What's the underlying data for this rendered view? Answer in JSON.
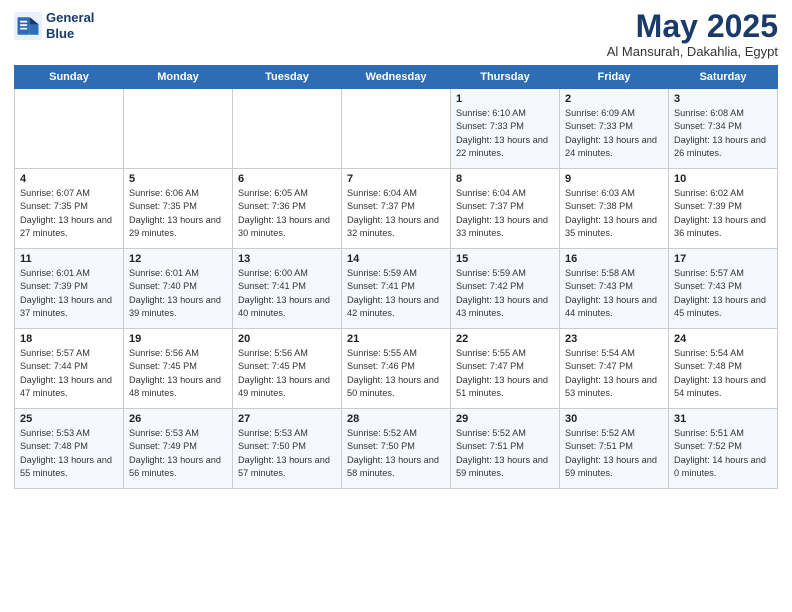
{
  "header": {
    "logo_line1": "General",
    "logo_line2": "Blue",
    "month": "May 2025",
    "location": "Al Mansurah, Dakahlia, Egypt"
  },
  "days_of_week": [
    "Sunday",
    "Monday",
    "Tuesday",
    "Wednesday",
    "Thursday",
    "Friday",
    "Saturday"
  ],
  "weeks": [
    [
      {
        "day": "",
        "sunrise": "",
        "sunset": "",
        "daylight": ""
      },
      {
        "day": "",
        "sunrise": "",
        "sunset": "",
        "daylight": ""
      },
      {
        "day": "",
        "sunrise": "",
        "sunset": "",
        "daylight": ""
      },
      {
        "day": "",
        "sunrise": "",
        "sunset": "",
        "daylight": ""
      },
      {
        "day": "1",
        "sunrise": "Sunrise: 6:10 AM",
        "sunset": "Sunset: 7:33 PM",
        "daylight": "Daylight: 13 hours and 22 minutes."
      },
      {
        "day": "2",
        "sunrise": "Sunrise: 6:09 AM",
        "sunset": "Sunset: 7:33 PM",
        "daylight": "Daylight: 13 hours and 24 minutes."
      },
      {
        "day": "3",
        "sunrise": "Sunrise: 6:08 AM",
        "sunset": "Sunset: 7:34 PM",
        "daylight": "Daylight: 13 hours and 26 minutes."
      }
    ],
    [
      {
        "day": "4",
        "sunrise": "Sunrise: 6:07 AM",
        "sunset": "Sunset: 7:35 PM",
        "daylight": "Daylight: 13 hours and 27 minutes."
      },
      {
        "day": "5",
        "sunrise": "Sunrise: 6:06 AM",
        "sunset": "Sunset: 7:35 PM",
        "daylight": "Daylight: 13 hours and 29 minutes."
      },
      {
        "day": "6",
        "sunrise": "Sunrise: 6:05 AM",
        "sunset": "Sunset: 7:36 PM",
        "daylight": "Daylight: 13 hours and 30 minutes."
      },
      {
        "day": "7",
        "sunrise": "Sunrise: 6:04 AM",
        "sunset": "Sunset: 7:37 PM",
        "daylight": "Daylight: 13 hours and 32 minutes."
      },
      {
        "day": "8",
        "sunrise": "Sunrise: 6:04 AM",
        "sunset": "Sunset: 7:37 PM",
        "daylight": "Daylight: 13 hours and 33 minutes."
      },
      {
        "day": "9",
        "sunrise": "Sunrise: 6:03 AM",
        "sunset": "Sunset: 7:38 PM",
        "daylight": "Daylight: 13 hours and 35 minutes."
      },
      {
        "day": "10",
        "sunrise": "Sunrise: 6:02 AM",
        "sunset": "Sunset: 7:39 PM",
        "daylight": "Daylight: 13 hours and 36 minutes."
      }
    ],
    [
      {
        "day": "11",
        "sunrise": "Sunrise: 6:01 AM",
        "sunset": "Sunset: 7:39 PM",
        "daylight": "Daylight: 13 hours and 37 minutes."
      },
      {
        "day": "12",
        "sunrise": "Sunrise: 6:01 AM",
        "sunset": "Sunset: 7:40 PM",
        "daylight": "Daylight: 13 hours and 39 minutes."
      },
      {
        "day": "13",
        "sunrise": "Sunrise: 6:00 AM",
        "sunset": "Sunset: 7:41 PM",
        "daylight": "Daylight: 13 hours and 40 minutes."
      },
      {
        "day": "14",
        "sunrise": "Sunrise: 5:59 AM",
        "sunset": "Sunset: 7:41 PM",
        "daylight": "Daylight: 13 hours and 42 minutes."
      },
      {
        "day": "15",
        "sunrise": "Sunrise: 5:59 AM",
        "sunset": "Sunset: 7:42 PM",
        "daylight": "Daylight: 13 hours and 43 minutes."
      },
      {
        "day": "16",
        "sunrise": "Sunrise: 5:58 AM",
        "sunset": "Sunset: 7:43 PM",
        "daylight": "Daylight: 13 hours and 44 minutes."
      },
      {
        "day": "17",
        "sunrise": "Sunrise: 5:57 AM",
        "sunset": "Sunset: 7:43 PM",
        "daylight": "Daylight: 13 hours and 45 minutes."
      }
    ],
    [
      {
        "day": "18",
        "sunrise": "Sunrise: 5:57 AM",
        "sunset": "Sunset: 7:44 PM",
        "daylight": "Daylight: 13 hours and 47 minutes."
      },
      {
        "day": "19",
        "sunrise": "Sunrise: 5:56 AM",
        "sunset": "Sunset: 7:45 PM",
        "daylight": "Daylight: 13 hours and 48 minutes."
      },
      {
        "day": "20",
        "sunrise": "Sunrise: 5:56 AM",
        "sunset": "Sunset: 7:45 PM",
        "daylight": "Daylight: 13 hours and 49 minutes."
      },
      {
        "day": "21",
        "sunrise": "Sunrise: 5:55 AM",
        "sunset": "Sunset: 7:46 PM",
        "daylight": "Daylight: 13 hours and 50 minutes."
      },
      {
        "day": "22",
        "sunrise": "Sunrise: 5:55 AM",
        "sunset": "Sunset: 7:47 PM",
        "daylight": "Daylight: 13 hours and 51 minutes."
      },
      {
        "day": "23",
        "sunrise": "Sunrise: 5:54 AM",
        "sunset": "Sunset: 7:47 PM",
        "daylight": "Daylight: 13 hours and 53 minutes."
      },
      {
        "day": "24",
        "sunrise": "Sunrise: 5:54 AM",
        "sunset": "Sunset: 7:48 PM",
        "daylight": "Daylight: 13 hours and 54 minutes."
      }
    ],
    [
      {
        "day": "25",
        "sunrise": "Sunrise: 5:53 AM",
        "sunset": "Sunset: 7:48 PM",
        "daylight": "Daylight: 13 hours and 55 minutes."
      },
      {
        "day": "26",
        "sunrise": "Sunrise: 5:53 AM",
        "sunset": "Sunset: 7:49 PM",
        "daylight": "Daylight: 13 hours and 56 minutes."
      },
      {
        "day": "27",
        "sunrise": "Sunrise: 5:53 AM",
        "sunset": "Sunset: 7:50 PM",
        "daylight": "Daylight: 13 hours and 57 minutes."
      },
      {
        "day": "28",
        "sunrise": "Sunrise: 5:52 AM",
        "sunset": "Sunset: 7:50 PM",
        "daylight": "Daylight: 13 hours and 58 minutes."
      },
      {
        "day": "29",
        "sunrise": "Sunrise: 5:52 AM",
        "sunset": "Sunset: 7:51 PM",
        "daylight": "Daylight: 13 hours and 59 minutes."
      },
      {
        "day": "30",
        "sunrise": "Sunrise: 5:52 AM",
        "sunset": "Sunset: 7:51 PM",
        "daylight": "Daylight: 13 hours and 59 minutes."
      },
      {
        "day": "31",
        "sunrise": "Sunrise: 5:51 AM",
        "sunset": "Sunset: 7:52 PM",
        "daylight": "Daylight: 14 hours and 0 minutes."
      }
    ]
  ]
}
